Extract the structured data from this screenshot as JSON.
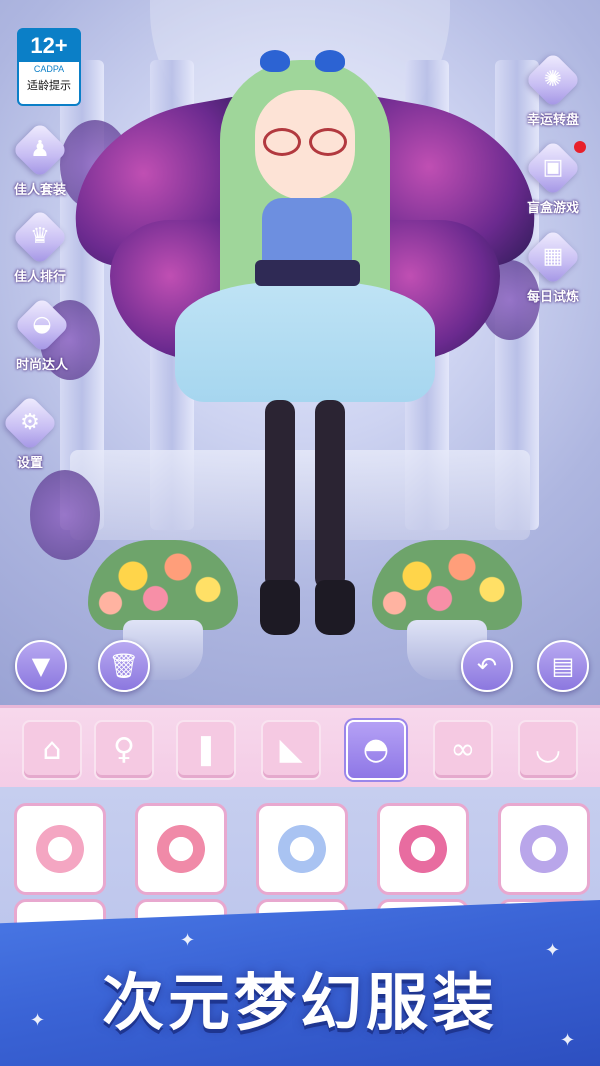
{
  "age_rating": {
    "number": "12+",
    "org": "CADPA",
    "tip": "适龄提示"
  },
  "left_menu": [
    {
      "label": "佳人套装",
      "icon": "dress-set-icon",
      "glyph": "♟"
    },
    {
      "label": "佳人排行",
      "icon": "trophy-icon",
      "glyph": "♛"
    },
    {
      "label": "时尚达人",
      "icon": "handbag-icon",
      "glyph": "◒"
    },
    {
      "label": "设置",
      "icon": "gear-icon",
      "glyph": "⚙"
    }
  ],
  "right_menu": [
    {
      "label": "幸运转盘",
      "icon": "lucky-wheel-icon",
      "glyph": "✺"
    },
    {
      "label": "盲盒游戏",
      "icon": "gift-box-icon",
      "glyph": "▣",
      "notification": true
    },
    {
      "label": "每日试炼",
      "icon": "calendar-icon",
      "glyph": "▦"
    }
  ],
  "actions": {
    "collapse": "▼",
    "delete": "🗑",
    "undo": "↶",
    "save": "▤"
  },
  "categories": [
    {
      "icon": "home-icon",
      "glyph": "⌂"
    },
    {
      "icon": "dress-icon",
      "glyph": "♀"
    },
    {
      "icon": "sock-icon",
      "glyph": "❚"
    },
    {
      "icon": "high-heel-icon",
      "glyph": "◣"
    },
    {
      "icon": "hat-icon",
      "glyph": "◓",
      "active": true
    },
    {
      "icon": "glasses-icon",
      "glyph": "∞"
    },
    {
      "icon": "necklace-icon",
      "glyph": "◡"
    }
  ],
  "items": [
    {
      "icon": "cat-ear-headband-icon",
      "color": "#f4a6c2"
    },
    {
      "icon": "flower-headband-icon",
      "color": "#f08aa8"
    },
    {
      "icon": "bow-headband-icon",
      "color": "#a9c3f2"
    },
    {
      "icon": "lace-headband-icon",
      "color": "#e86ca0"
    },
    {
      "icon": "witch-hat-icon",
      "color": "#b9a6ea"
    }
  ],
  "banner": {
    "title": "次元梦幻服装"
  },
  "colors": {
    "accent": "#8e77e6",
    "category_bg": "#f5c9e2",
    "banner": "#3a63d5",
    "card_border": "#e8a8cf"
  }
}
